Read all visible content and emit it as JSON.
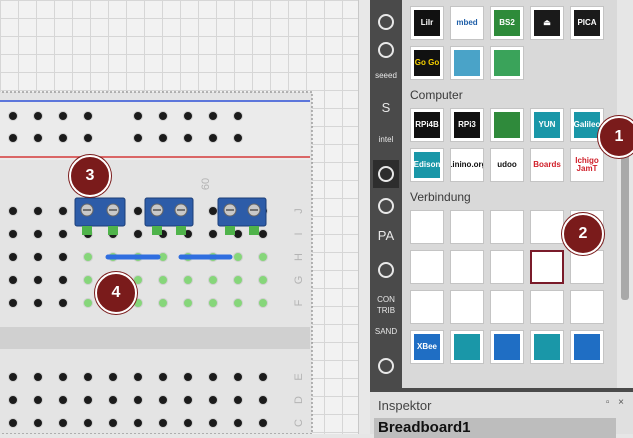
{
  "bin": {
    "tabs": [
      {
        "icon": "arduino-icon"
      },
      {
        "icon": "flame-icon"
      },
      {
        "icon": "seeed-icon",
        "label": "seeed"
      },
      {
        "icon": "snootlab-icon",
        "label": "S"
      },
      {
        "icon": "intel-icon",
        "label": "intel"
      },
      {
        "icon": "play-icon"
      },
      {
        "icon": "circuit-icon"
      },
      {
        "icon": "pa-icon",
        "label": "PA"
      },
      {
        "icon": "horse-icon"
      },
      {
        "icon": "contrib-icon",
        "label": "CON TRIB"
      },
      {
        "icon": "lilypad-icon",
        "label": "SAND"
      },
      {
        "icon": "recycle-icon"
      }
    ],
    "top_parts": [
      {
        "name": "lilypad-board",
        "text": "LiIr",
        "bg": "#111111",
        "fg": "#ffffff"
      },
      {
        "name": "mbed-board",
        "text": "mbed",
        "bg": "#ffffff",
        "fg": "#1f5fa8"
      },
      {
        "name": "bs2-board",
        "text": "BS2",
        "bg": "#2e8b3a",
        "fg": "#ffffff"
      },
      {
        "name": "propeller-chip",
        "text": "⏏",
        "bg": "#1a1a1a",
        "fg": "#ffffff"
      },
      {
        "name": "pica-chip",
        "text": "PICA",
        "bg": "#1a1a1a",
        "fg": "#ffffff"
      },
      {
        "name": "gogo-board",
        "text": "Go Go",
        "bg": "#111111",
        "fg": "#f5d000"
      },
      {
        "name": "blue-strip-board",
        "text": "",
        "bg": "#4aa3c8",
        "fg": "#ffffff"
      },
      {
        "name": "green-small-board",
        "text": "",
        "bg": "#3aa35a",
        "fg": "#ffffff"
      }
    ],
    "categories": [
      {
        "title": "Computer",
        "parts": [
          {
            "name": "raspberry-pi-4b",
            "text": "RPi4B",
            "bg": "#111111",
            "fg": "#ffffff"
          },
          {
            "name": "raspberry-pi-3",
            "text": "RPi3",
            "bg": "#111111",
            "fg": "#ffffff"
          },
          {
            "name": "raspberry-pi-zero",
            "text": "",
            "bg": "#2f8a3b",
            "fg": "#ffffff"
          },
          {
            "name": "arduino-yun",
            "text": "YUN",
            "bg": "#1a97a8",
            "fg": "#ffffff"
          },
          {
            "name": "intel-galileo",
            "text": "Galileo",
            "bg": "#1a97a8",
            "fg": "#ffffff"
          },
          {
            "name": "intel-edison",
            "text": "Edison",
            "bg": "#1a97a8",
            "fg": "#ffffff"
          },
          {
            "name": "linino-org",
            "text": "Linino.org",
            "bg": "#ffffff",
            "fg": "#111111"
          },
          {
            "name": "udoo",
            "text": "udoo",
            "bg": "#ffffff",
            "fg": "#111111"
          },
          {
            "name": "boards-org",
            "text": "Boards",
            "bg": "#ffffff",
            "fg": "#d0202a"
          },
          {
            "name": "ichigo-jam",
            "text": "Ichigo JamT",
            "bg": "#ffffff",
            "fg": "#d0202a"
          }
        ]
      },
      {
        "title": "Verbindung",
        "parts": [
          {
            "name": "connector-black-square",
            "text": "",
            "bg": "#ffffff",
            "fg": "#111111"
          },
          {
            "name": "pin-header",
            "text": "",
            "bg": "#ffffff",
            "fg": "#111111"
          },
          {
            "name": "jst-connector",
            "text": "",
            "bg": "#ffffff",
            "fg": "#111111"
          },
          {
            "name": "power-jack",
            "text": "",
            "bg": "#ffffff",
            "fg": "#111111"
          },
          {
            "name": "barrel-connector",
            "text": "",
            "bg": "#ffffff",
            "fg": "#111111"
          },
          {
            "name": "screw-connector-grey",
            "text": "",
            "bg": "#ffffff",
            "fg": "#111111"
          },
          {
            "name": "molex-white",
            "text": "",
            "bg": "#ffffff",
            "fg": "#111111"
          },
          {
            "name": "molex-multi",
            "text": "",
            "bg": "#ffffff",
            "fg": "#111111"
          },
          {
            "name": "screw-terminal",
            "text": "",
            "bg": "#ffffff",
            "fg": "#111111"
          },
          {
            "name": "green-header",
            "text": "",
            "bg": "#ffffff",
            "fg": "#111111"
          },
          {
            "name": "db9-connector",
            "text": "",
            "bg": "#ffffff",
            "fg": "#111111"
          },
          {
            "name": "usb-connector",
            "text": "",
            "bg": "#ffffff",
            "fg": "#111111"
          },
          {
            "name": "ps2-connector",
            "text": "",
            "bg": "#ffffff",
            "fg": "#111111"
          },
          {
            "name": "rj45-jack",
            "text": "",
            "bg": "#ffffff",
            "fg": "#111111"
          },
          {
            "name": "sd-card-slot",
            "text": "",
            "bg": "#ffffff",
            "fg": "#111111"
          },
          {
            "name": "xbee-module",
            "text": "XBee",
            "bg": "#1f6ec4",
            "fg": "#ffffff"
          },
          {
            "name": "arduino-shield",
            "text": "",
            "bg": "#1a97a8",
            "fg": "#ffffff"
          },
          {
            "name": "xbee-adapter",
            "text": "",
            "bg": "#1f6ec4",
            "fg": "#ffffff"
          },
          {
            "name": "arduino-mega-shield",
            "text": "",
            "bg": "#1a97a8",
            "fg": "#ffffff"
          },
          {
            "name": "proto-shield",
            "text": "",
            "bg": "#1f6ec4",
            "fg": "#ffffff"
          }
        ]
      }
    ]
  },
  "breadboard": {
    "column_number": "60",
    "row_letters_upper": [
      "J",
      "I",
      "H",
      "G",
      "F"
    ],
    "row_letters_lower": [
      "E",
      "D",
      "C"
    ]
  },
  "inspector": {
    "title": "Inspektor",
    "controls": "▫ ×",
    "selected_name": "Breadboard1"
  },
  "callouts": [
    "1",
    "2",
    "3",
    "4"
  ],
  "colors": {
    "callout": "#7a1b1b",
    "power_rail_blue": "#2d4fd6",
    "power_rail_red": "#d43a3a",
    "connected_hole": "#86d67a",
    "wire": "#2f6ee0",
    "terminal_block": "#2d5ca8"
  }
}
